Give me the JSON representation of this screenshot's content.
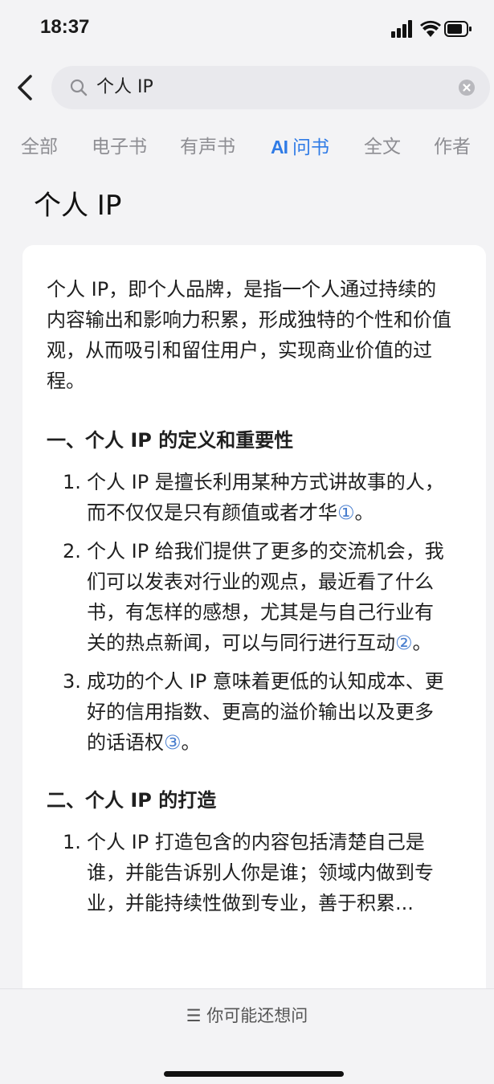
{
  "status": {
    "time": "18:37"
  },
  "search": {
    "query": "个人 IP"
  },
  "tabs": [
    {
      "label": "全部",
      "active": false
    },
    {
      "label": "电子书",
      "active": false
    },
    {
      "label": "有声书",
      "active": false
    },
    {
      "label": "问书",
      "prefix": "AI",
      "active": true
    },
    {
      "label": "全文",
      "active": false
    },
    {
      "label": "作者",
      "active": false
    }
  ],
  "page": {
    "title": "个人 IP"
  },
  "answer": {
    "intro": "个人 IP，即个人品牌，是指一个人通过持续的内容输出和影响力积累，形成独特的个性和价值观，从而吸引和留住用户，实现商业价值的过程。",
    "sections": [
      {
        "heading": "一、个人 IP 的定义和重要性",
        "items": [
          {
            "num": "1.",
            "text": "个人 IP 是擅长利用某种方式讲故事的人，而不仅仅是只有颜值或者才华",
            "cite": "①",
            "end": "。"
          },
          {
            "num": "2.",
            "text": "个人 IP 给我们提供了更多的交流机会，我们可以发表对行业的观点，最近看了什么书，有怎样的感想，尤其是与自己行业有关的热点新闻，可以与同行进行互动",
            "cite": "②",
            "end": "。"
          },
          {
            "num": "3.",
            "text": "成功的个人 IP 意味着更低的认知成本、更好的信用指数、更高的溢价输出以及更多的话语权",
            "cite": "③",
            "end": "。"
          }
        ]
      },
      {
        "heading": "二、个人 IP 的打造",
        "items": [
          {
            "num": "1.",
            "text": "个人 IP 打造包含的内容包括清楚自己是谁，并能告诉别人你是谁；领域内做到专业，并能持续性做到专业，善于积累...",
            "cite": "",
            "end": ""
          }
        ]
      }
    ]
  },
  "bottom": {
    "suggest_icon": "☰",
    "suggest_label": "你可能还想问"
  },
  "colors": {
    "accent": "#2f7be6",
    "cite": "#4a7fcf",
    "background": "#f3f3f5",
    "card": "#ffffff"
  },
  "icons": [
    "back-chevron-icon",
    "search-icon",
    "clear-icon",
    "signal-icon",
    "wifi-icon",
    "battery-icon"
  ]
}
